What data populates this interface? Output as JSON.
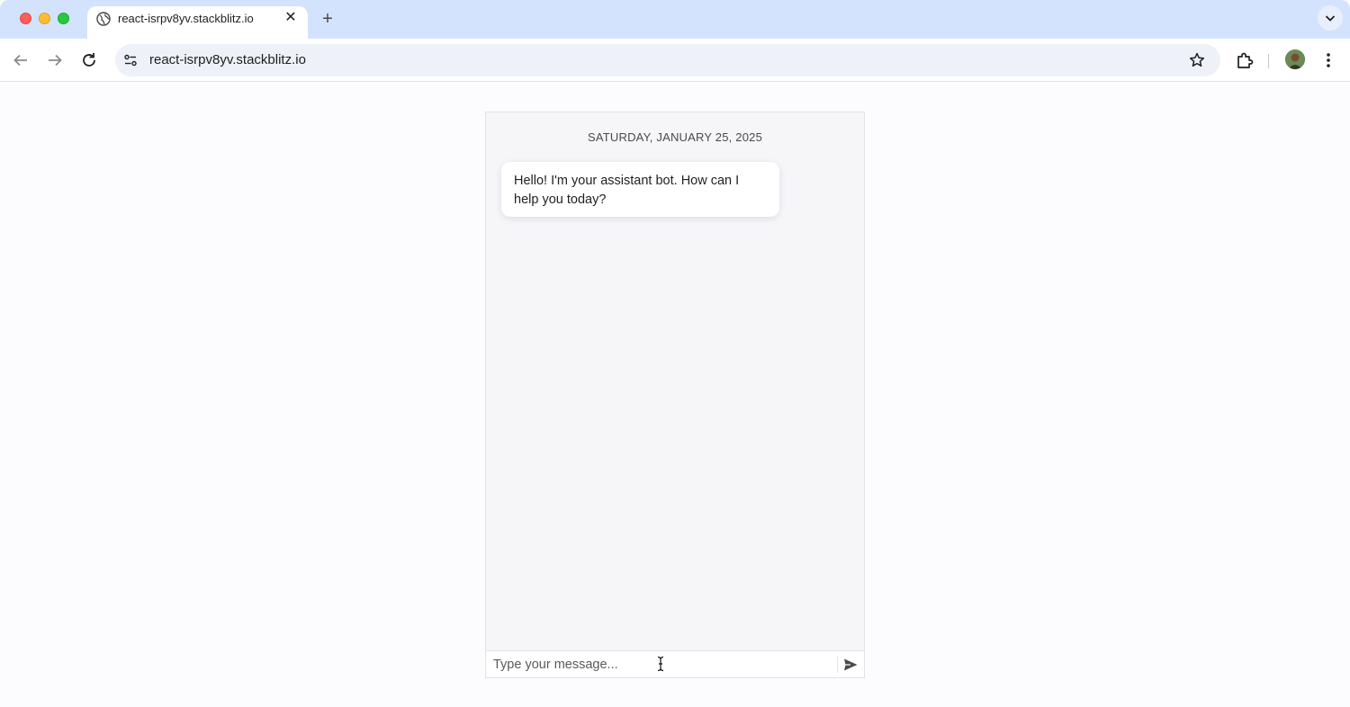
{
  "browser": {
    "tab": {
      "title": "react-isrpv8yv.stackblitz.io",
      "icon": "globe-icon"
    },
    "address_bar": {
      "url": "react-isrpv8yv.stackblitz.io"
    }
  },
  "chat": {
    "date_header": "SATURDAY, JANUARY 25, 2025",
    "messages": [
      {
        "sender": "bot",
        "text": "Hello! I'm your assistant bot. How can I help you today?"
      }
    ],
    "input": {
      "placeholder": "Type your message...",
      "value": ""
    },
    "send_icon": "send-icon"
  },
  "colors": {
    "tabstrip_bg": "#d3e3fd",
    "page_bg": "#fcfbfe",
    "chat_bg": "#f6f5f8"
  }
}
